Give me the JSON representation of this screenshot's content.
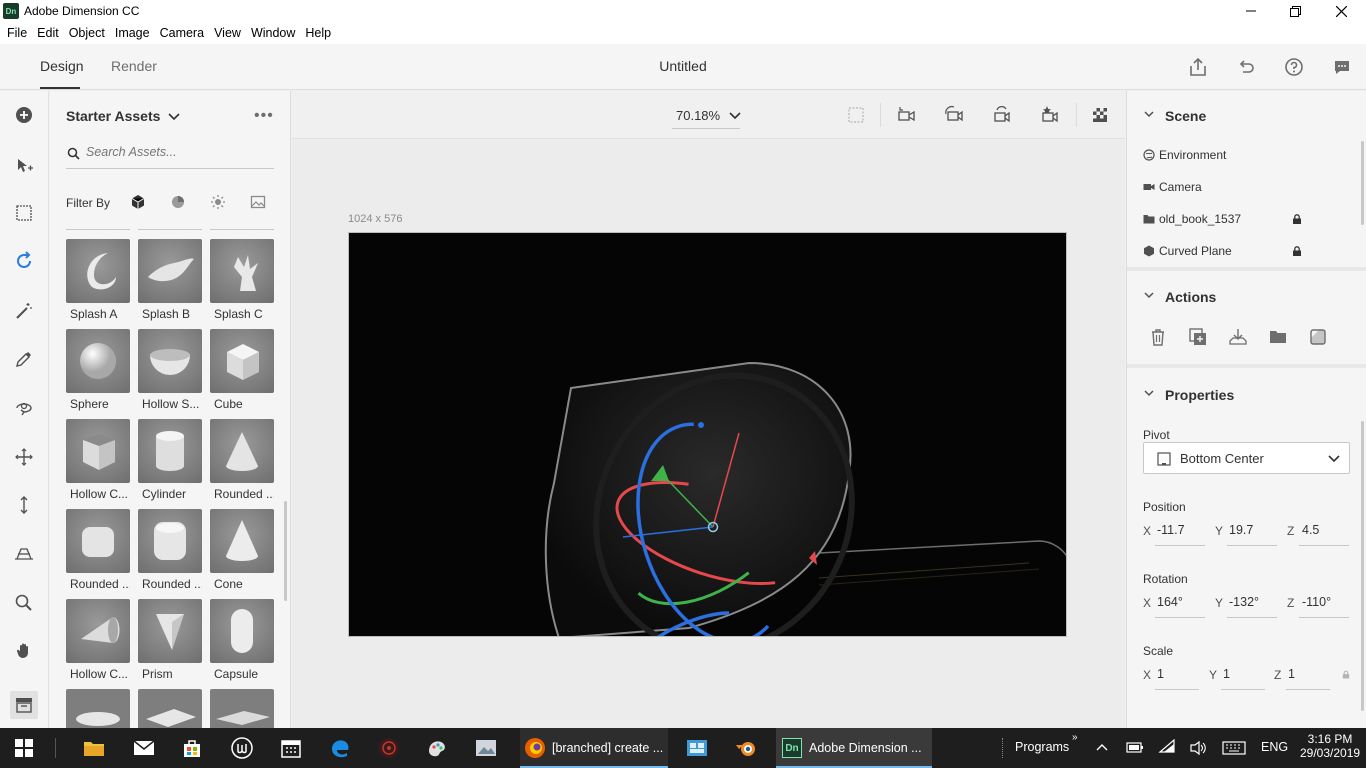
{
  "window": {
    "title": "Adobe Dimension CC",
    "app_badge": "Dn"
  },
  "menu": [
    "File",
    "Edit",
    "Object",
    "Image",
    "Camera",
    "View",
    "Window",
    "Help"
  ],
  "header": {
    "tabs": [
      "Design",
      "Render"
    ],
    "doc_title": "Untitled"
  },
  "assets": {
    "title": "Starter Assets",
    "more": "•••",
    "search_placeholder": "Search Assets...",
    "filter_label": "Filter By",
    "items": [
      {
        "label": "Splash A"
      },
      {
        "label": "Splash B"
      },
      {
        "label": "Splash C"
      },
      {
        "label": "Sphere"
      },
      {
        "label": "Hollow S..."
      },
      {
        "label": "Cube"
      },
      {
        "label": "Hollow C..."
      },
      {
        "label": "Cylinder"
      },
      {
        "label": "Rounded ..."
      },
      {
        "label": "Rounded ..."
      },
      {
        "label": "Rounded ..."
      },
      {
        "label": "Cone"
      },
      {
        "label": "Hollow C..."
      },
      {
        "label": "Prism"
      },
      {
        "label": "Capsule"
      }
    ]
  },
  "canvas": {
    "zoom": "70.18%",
    "dims": "1024 x 576"
  },
  "scene": {
    "title": "Scene",
    "items": [
      {
        "label": "Environment",
        "locked": false
      },
      {
        "label": "Camera",
        "locked": false
      },
      {
        "label": "old_book_1537",
        "locked": true
      },
      {
        "label": "Curved Plane",
        "locked": true
      }
    ]
  },
  "actions": {
    "title": "Actions"
  },
  "properties": {
    "title": "Properties",
    "pivot_label": "Pivot",
    "pivot_value": "Bottom Center",
    "position_label": "Position",
    "position": {
      "x": "-11.7",
      "y": "19.7",
      "z": "4.5"
    },
    "rotation_label": "Rotation",
    "rotation": {
      "x": "164°",
      "y": "-132°",
      "z": "-110°"
    },
    "scale_label": "Scale",
    "scale": {
      "x": "1",
      "y": "1",
      "z": "1"
    },
    "axis_labels": {
      "x": "X",
      "y": "Y",
      "z": "Z"
    }
  },
  "taskbar": {
    "firefox_label": "[branched] create ...",
    "dimension_label": "Adobe Dimension ...",
    "programs": "Programs",
    "lang": "ENG",
    "time": "3:16 PM",
    "date": "29/03/2019"
  },
  "colors": {
    "accent": "#323232",
    "gizmo_red": "#e5484d",
    "gizmo_green": "#3fb24a",
    "gizmo_blue": "#2b6fe0",
    "taskbar": "#1e1e1e"
  }
}
